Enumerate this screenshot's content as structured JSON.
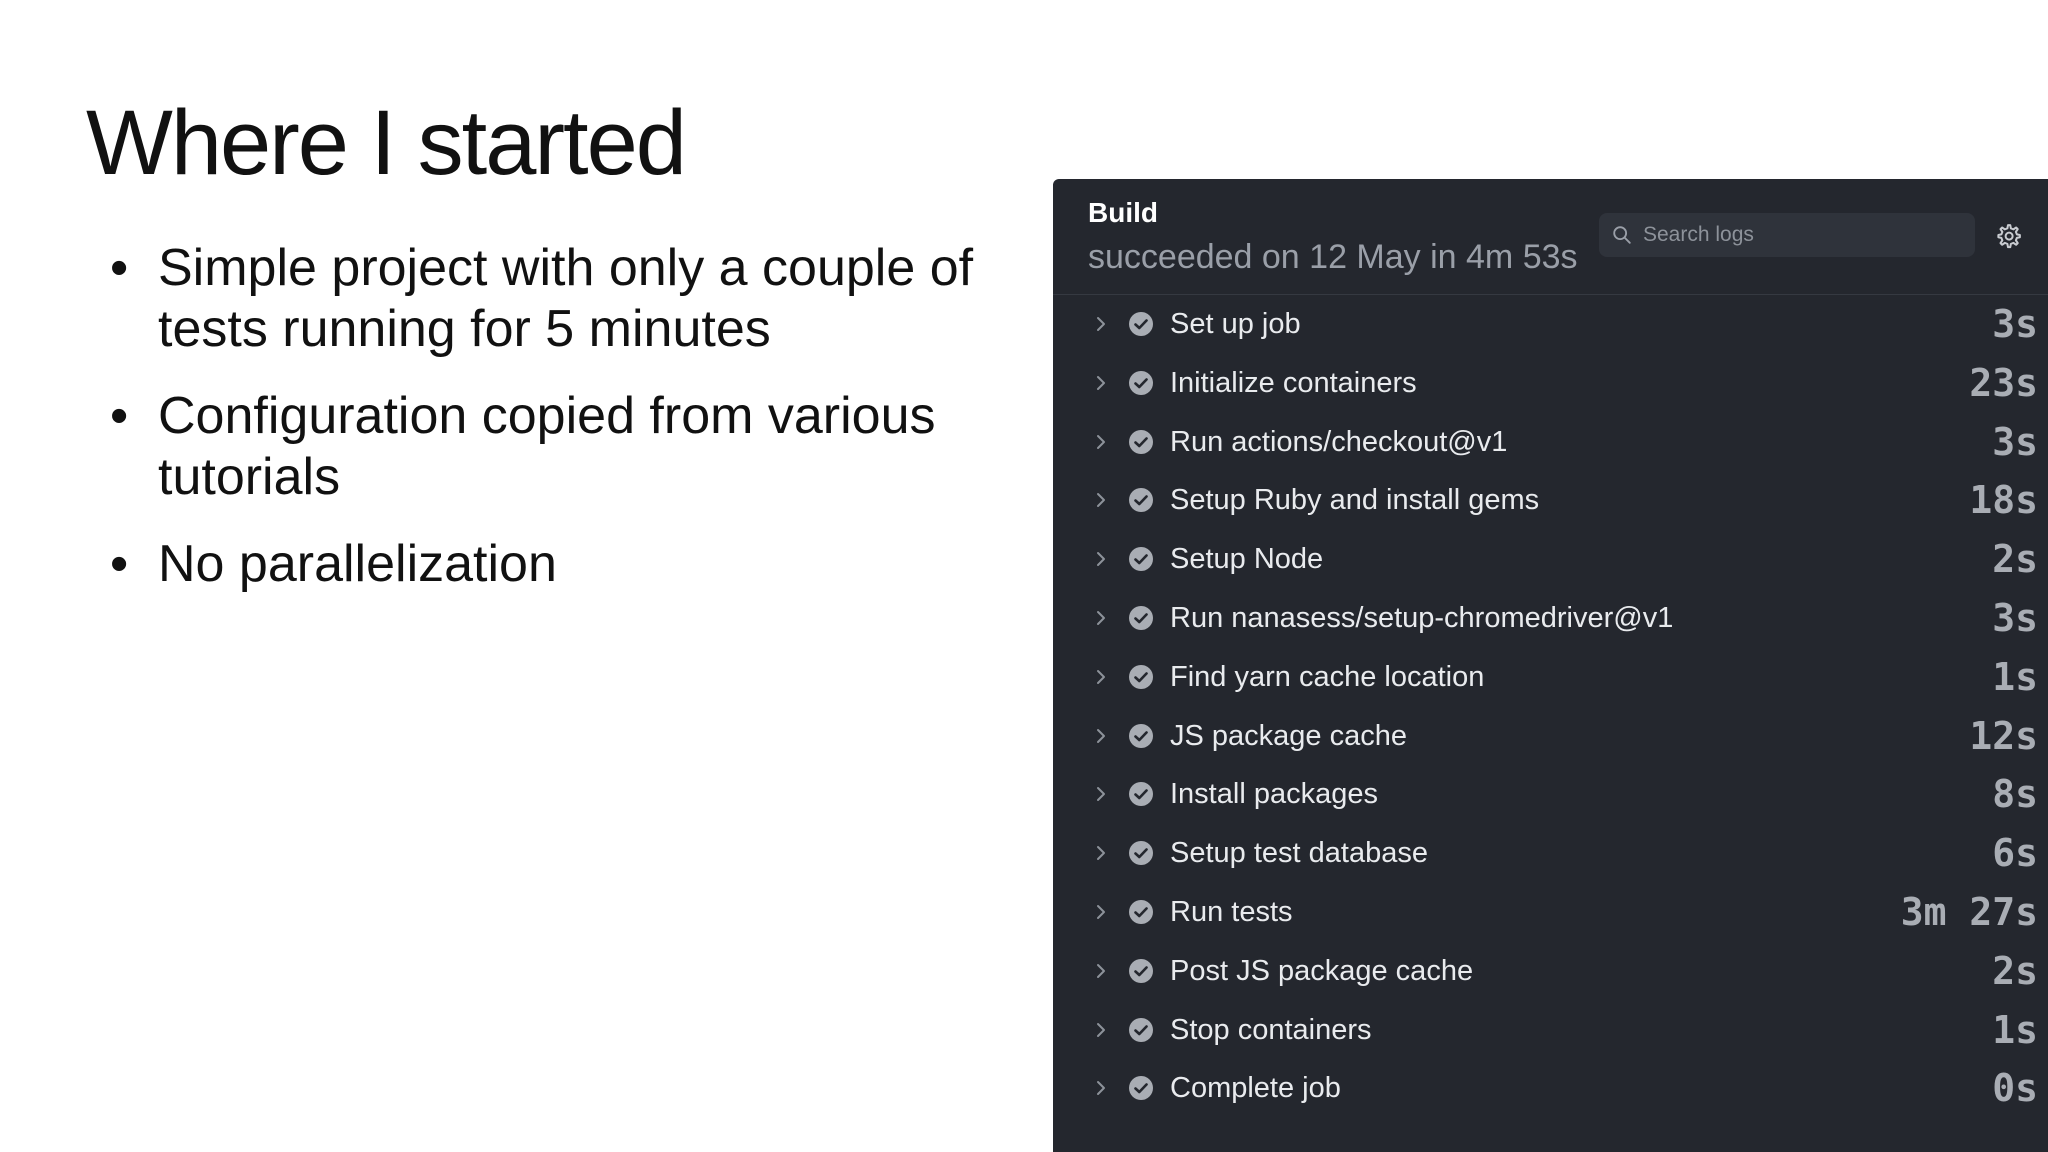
{
  "slide": {
    "title": "Where I started",
    "bullet_symbol": "•",
    "bullets": [
      "Simple project with only a couple of tests running for 5 minutes",
      "Configuration copied from various tutorials",
      "No parallelization"
    ]
  },
  "build": {
    "title": "Build",
    "subtitle": "succeeded on 12 May in 4m 53s",
    "search": {
      "placeholder": "Search logs",
      "value": ""
    },
    "settings_icon": "gear-icon",
    "step_icons": {
      "expand": "chevron-right-icon",
      "status": "check-circle-icon"
    },
    "steps": [
      {
        "name": "Set up job",
        "duration": "3s"
      },
      {
        "name": "Initialize containers",
        "duration": "23s"
      },
      {
        "name": "Run actions/checkout@v1",
        "duration": "3s"
      },
      {
        "name": "Setup Ruby and install gems",
        "duration": "18s"
      },
      {
        "name": "Setup Node",
        "duration": "2s"
      },
      {
        "name": "Run nanasess/setup-chromedriver@v1",
        "duration": "3s"
      },
      {
        "name": "Find yarn cache location",
        "duration": "1s"
      },
      {
        "name": "JS package cache",
        "duration": "12s"
      },
      {
        "name": "Install packages",
        "duration": "8s"
      },
      {
        "name": "Setup test database",
        "duration": "6s"
      },
      {
        "name": "Run tests",
        "duration": "3m 27s"
      },
      {
        "name": "Post JS package cache",
        "duration": "2s"
      },
      {
        "name": "Stop containers",
        "duration": "1s"
      },
      {
        "name": "Complete job",
        "duration": "0s"
      }
    ],
    "colors": {
      "panel_background": "#24272e",
      "search_background": "#2f333b",
      "step_text": "#e9ebee",
      "muted_text": "#9a9fa8",
      "success_icon": "#a9adb4"
    }
  }
}
